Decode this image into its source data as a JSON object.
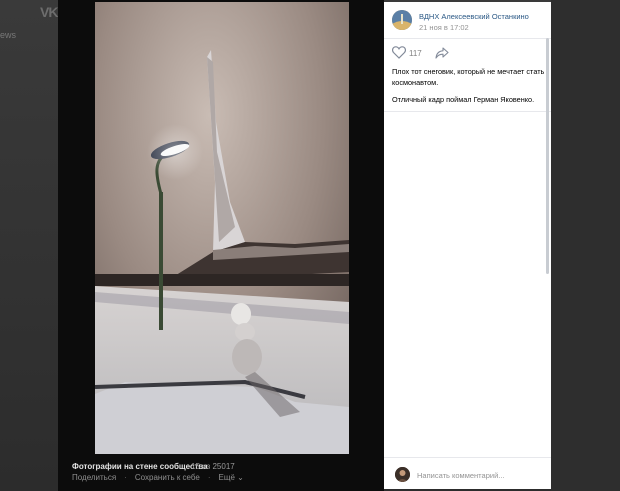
{
  "background": {
    "logo_text": "VK",
    "side_text": "ews"
  },
  "viewer": {
    "caption_title": "Фотографии на стене сообщества",
    "caption_count": "15 из 25017",
    "actions": [
      "Поделиться",
      "Сохранить к себе",
      "Ещё ⌄"
    ],
    "separator": "·"
  },
  "post": {
    "group_name": "ВДНХ Алексеевский Останкино",
    "date": "21 ноя в 17:02",
    "likes": "117",
    "text": "Плох тот снеговик, который не мечтает стать космонавтом.",
    "credit": "Отличный кадр поймал Герман Яковенко."
  },
  "comment": {
    "placeholder": "Написать комментарий..."
  },
  "icons": {
    "like": "heart-icon",
    "share": "share-arrow-icon"
  },
  "colors": {
    "link": "#2a5885",
    "muted": "#939393",
    "page_bg": "#2f2f2f",
    "viewer_bg": "#0c0c0c"
  }
}
